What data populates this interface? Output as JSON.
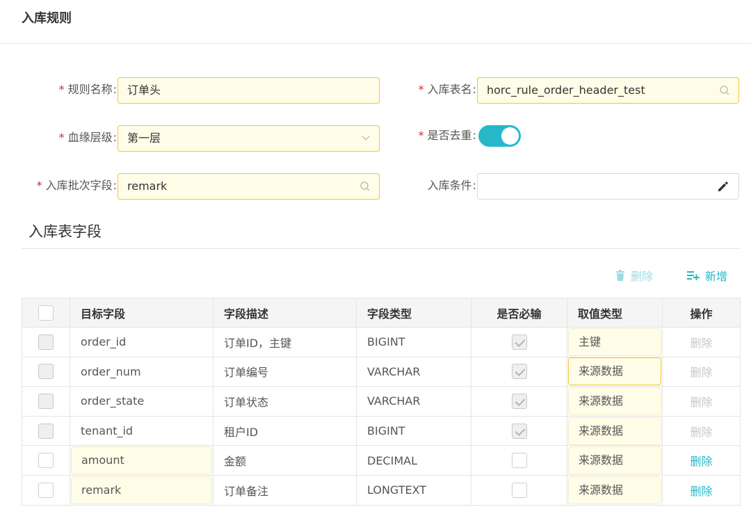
{
  "page": {
    "title": "入库规则"
  },
  "form": {
    "rule_name": {
      "label": "规则名称",
      "value": "订单头"
    },
    "table_name": {
      "label": "入库表名",
      "value": "horc_rule_order_header_test"
    },
    "lineage_level": {
      "label": "血缘层级",
      "value": "第一层"
    },
    "dedup": {
      "label": "是否去重",
      "on": true
    },
    "batch_field": {
      "label": "入库批次字段",
      "value": "remark"
    },
    "condition": {
      "label": "入库条件",
      "value": ""
    },
    "colon": ":",
    "required_mark": "*"
  },
  "fields_section": {
    "title": "入库表字段"
  },
  "toolbar": {
    "delete_label": "删除",
    "add_label": "新增"
  },
  "table": {
    "columns": [
      "目标字段",
      "字段描述",
      "字段类型",
      "是否必输",
      "取值类型",
      "操作"
    ],
    "rows": [
      {
        "target": "order_id",
        "desc": "订单ID，主键",
        "type": "BIGINT",
        "required": true,
        "value_type": "主键",
        "op": "删除",
        "editable": false
      },
      {
        "target": "order_num",
        "desc": "订单编号",
        "type": "VARCHAR",
        "required": true,
        "value_type": "来源数据",
        "op": "删除",
        "editable": false
      },
      {
        "target": "order_state",
        "desc": "订单状态",
        "type": "VARCHAR",
        "required": true,
        "value_type": "来源数据",
        "op": "删除",
        "editable": false
      },
      {
        "target": "tenant_id",
        "desc": "租户ID",
        "type": "BIGINT",
        "required": true,
        "value_type": "来源数据",
        "op": "删除",
        "editable": false
      },
      {
        "target": "amount",
        "desc": "金额",
        "type": "DECIMAL",
        "required": false,
        "value_type": "来源数据",
        "op": "删除",
        "editable": true
      },
      {
        "target": "remark",
        "desc": "订单备注",
        "type": "LONGTEXT",
        "required": false,
        "value_type": "来源数据",
        "op": "删除",
        "editable": true
      }
    ]
  },
  "colors": {
    "accent": "#26b8c9",
    "required": "#e5262c",
    "field_bg": "#fffde7",
    "field_border": "#f2c537"
  },
  "icons": [
    "search-icon",
    "chevron-down-icon",
    "edit-pencil-icon",
    "trash-icon",
    "add-list-icon"
  ]
}
